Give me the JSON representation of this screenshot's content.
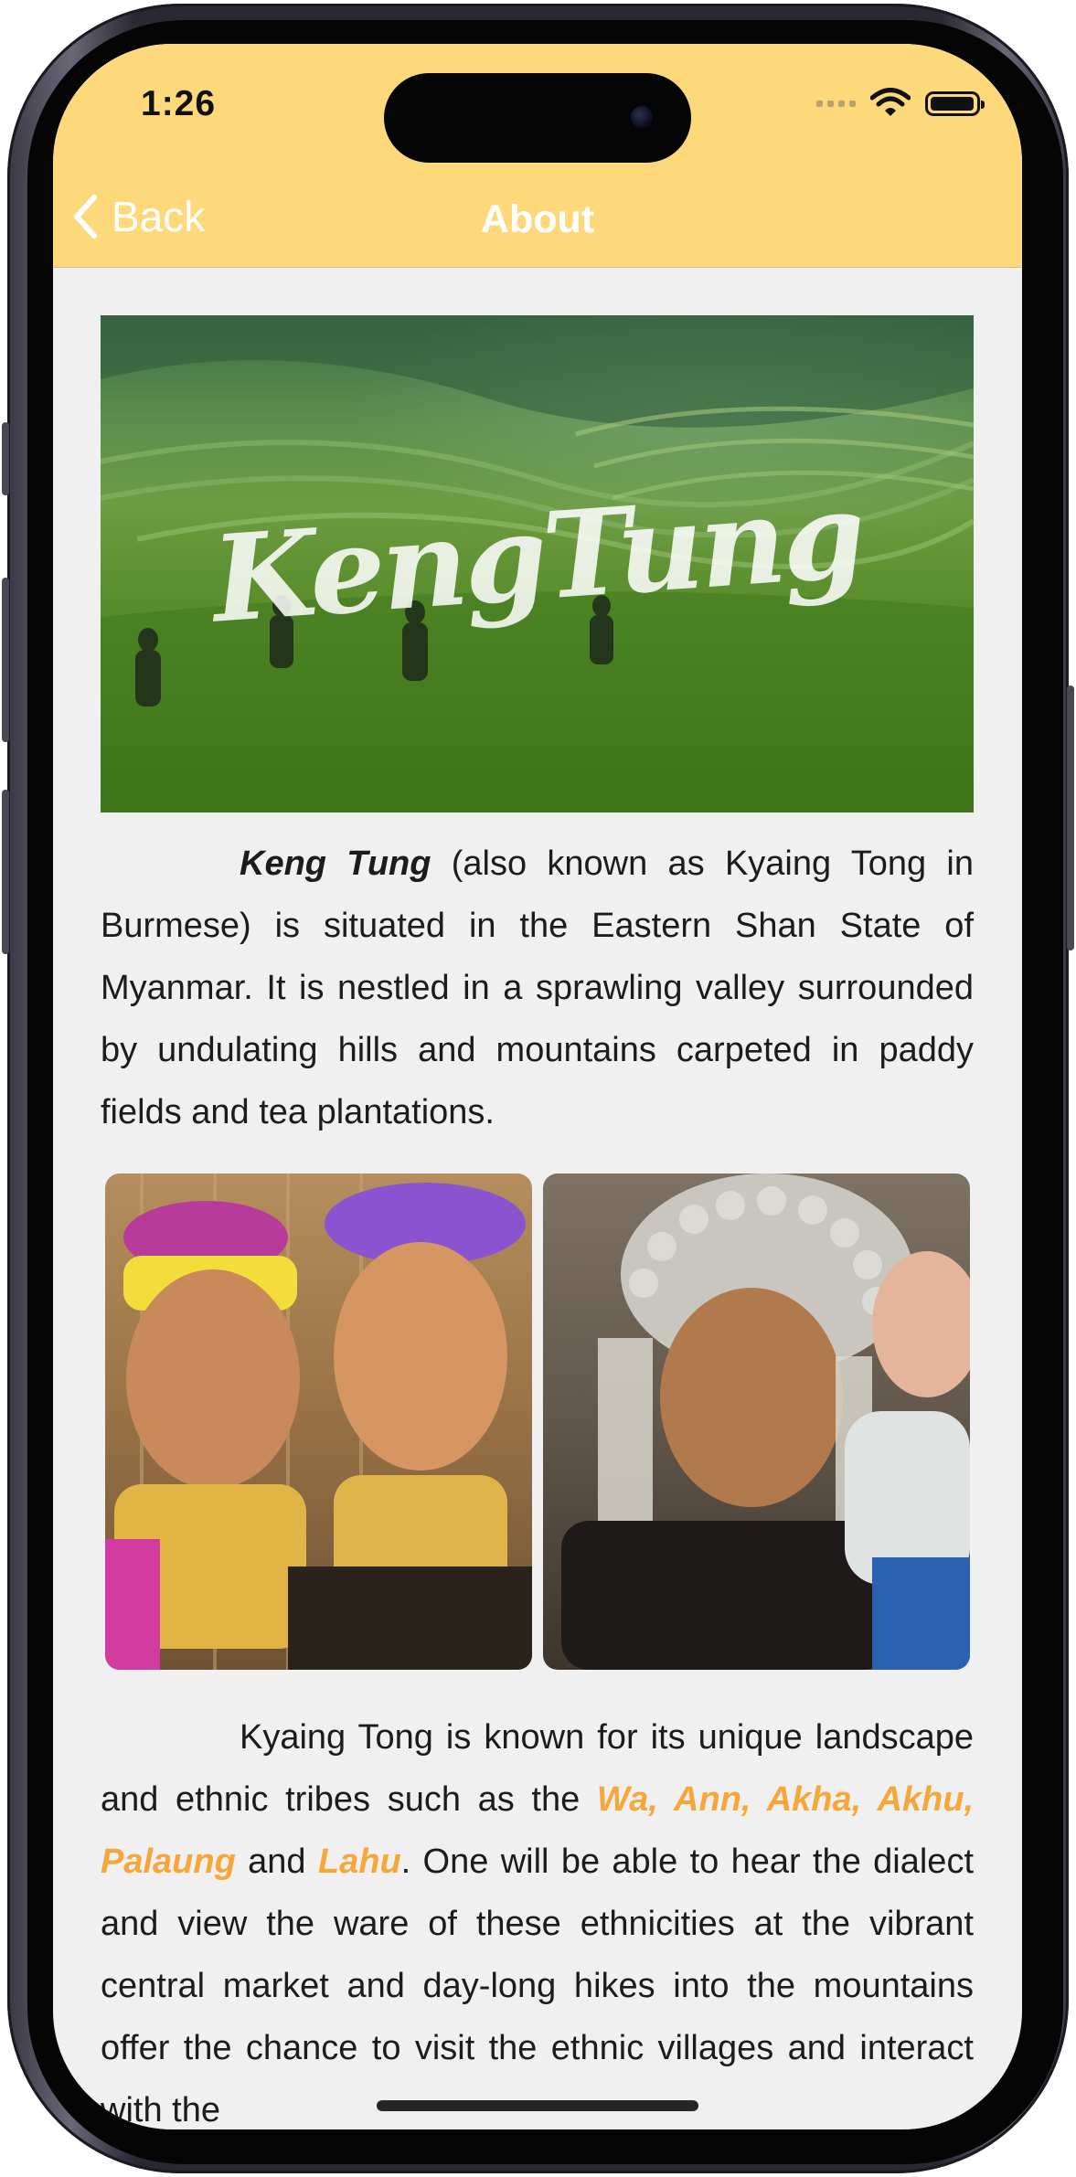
{
  "status_bar": {
    "time": "1:26"
  },
  "nav": {
    "back_label": "Back",
    "title": "About"
  },
  "hero": {
    "overlay_text": "KengTung"
  },
  "intro": {
    "bold_name": "Keng Tung",
    "text": " (also known as Kyaing Tong in Burmese) is situated in the Eastern Shan State of Myanmar. It is nestled in a sprawling valley surrounded by undulating hills and mountains carpeted in paddy fields and tea plantations."
  },
  "photos": [
    {
      "name": "tribe-girls-photo"
    },
    {
      "name": "akha-woman-photo"
    }
  ],
  "tribes": {
    "lead": "Kyaing Tong is known for its unique landscape and ethnic tribes such as the ",
    "highlight_1": "Wa, Ann, Akha, Akhu, Palaung",
    "middle": " and ",
    "highlight_2": "Lahu",
    "tail": ". One will be able to hear the dialect and view the ware of these ethnicities at the vibrant central market and day-long hikes into the mountains offer the chance to visit the ethnic villages and interact with the"
  },
  "colors": {
    "header": "#fdd97b",
    "highlight": "#f7a73a",
    "background": "#f1f0f1"
  }
}
